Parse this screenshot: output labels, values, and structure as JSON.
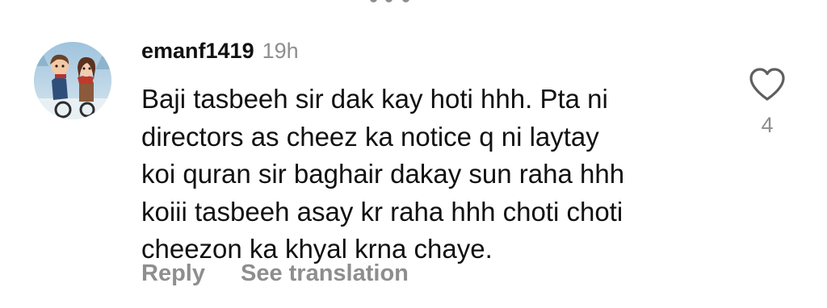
{
  "comment": {
    "username": "emanf1419",
    "timestamp": "19h",
    "avatar_icon": "cartoon-couple-avatar-icon",
    "text_lines": [
      "Baji tasbeeh sir dak kay hoti hhh. Pta ni",
      "directors as cheez ka notice q ni laytay",
      "koi quran sir baghair dakay sun raha hhh",
      "koiii tasbeeh asay kr raha hhh choti choti",
      "cheezon ka khyal krna chaye."
    ],
    "like_icon": "heart-outline-icon",
    "like_count": "4",
    "actions": {
      "reply_label": "Reply",
      "translate_label": "See translation"
    }
  },
  "colors": {
    "text_primary": "#111111",
    "text_secondary": "#8e8e8e",
    "background": "#ffffff"
  }
}
